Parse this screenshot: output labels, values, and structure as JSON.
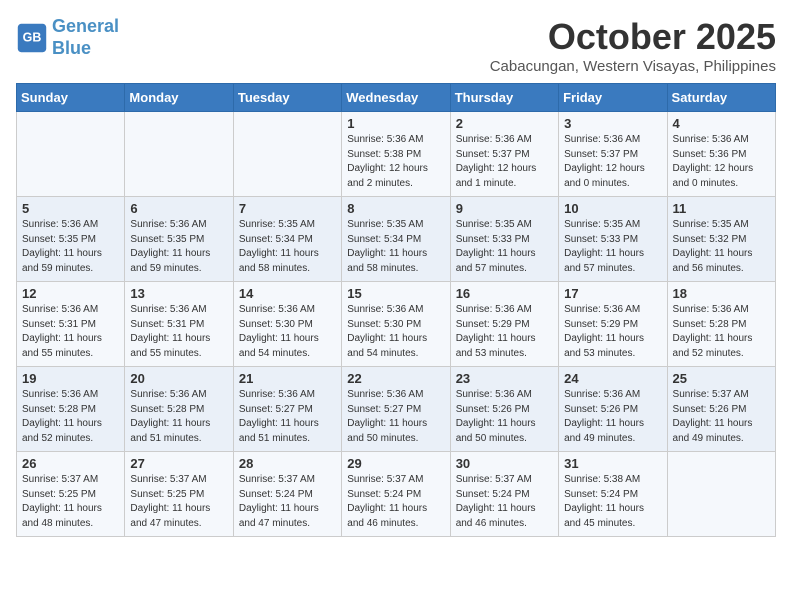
{
  "logo": {
    "line1": "General",
    "line2": "Blue"
  },
  "title": "October 2025",
  "location": "Cabacungan, Western Visayas, Philippines",
  "weekdays": [
    "Sunday",
    "Monday",
    "Tuesday",
    "Wednesday",
    "Thursday",
    "Friday",
    "Saturday"
  ],
  "weeks": [
    [
      {
        "day": "",
        "info": ""
      },
      {
        "day": "",
        "info": ""
      },
      {
        "day": "",
        "info": ""
      },
      {
        "day": "1",
        "info": "Sunrise: 5:36 AM\nSunset: 5:38 PM\nDaylight: 12 hours\nand 2 minutes."
      },
      {
        "day": "2",
        "info": "Sunrise: 5:36 AM\nSunset: 5:37 PM\nDaylight: 12 hours\nand 1 minute."
      },
      {
        "day": "3",
        "info": "Sunrise: 5:36 AM\nSunset: 5:37 PM\nDaylight: 12 hours\nand 0 minutes."
      },
      {
        "day": "4",
        "info": "Sunrise: 5:36 AM\nSunset: 5:36 PM\nDaylight: 12 hours\nand 0 minutes."
      }
    ],
    [
      {
        "day": "5",
        "info": "Sunrise: 5:36 AM\nSunset: 5:35 PM\nDaylight: 11 hours\nand 59 minutes."
      },
      {
        "day": "6",
        "info": "Sunrise: 5:36 AM\nSunset: 5:35 PM\nDaylight: 11 hours\nand 59 minutes."
      },
      {
        "day": "7",
        "info": "Sunrise: 5:35 AM\nSunset: 5:34 PM\nDaylight: 11 hours\nand 58 minutes."
      },
      {
        "day": "8",
        "info": "Sunrise: 5:35 AM\nSunset: 5:34 PM\nDaylight: 11 hours\nand 58 minutes."
      },
      {
        "day": "9",
        "info": "Sunrise: 5:35 AM\nSunset: 5:33 PM\nDaylight: 11 hours\nand 57 minutes."
      },
      {
        "day": "10",
        "info": "Sunrise: 5:35 AM\nSunset: 5:33 PM\nDaylight: 11 hours\nand 57 minutes."
      },
      {
        "day": "11",
        "info": "Sunrise: 5:35 AM\nSunset: 5:32 PM\nDaylight: 11 hours\nand 56 minutes."
      }
    ],
    [
      {
        "day": "12",
        "info": "Sunrise: 5:36 AM\nSunset: 5:31 PM\nDaylight: 11 hours\nand 55 minutes."
      },
      {
        "day": "13",
        "info": "Sunrise: 5:36 AM\nSunset: 5:31 PM\nDaylight: 11 hours\nand 55 minutes."
      },
      {
        "day": "14",
        "info": "Sunrise: 5:36 AM\nSunset: 5:30 PM\nDaylight: 11 hours\nand 54 minutes."
      },
      {
        "day": "15",
        "info": "Sunrise: 5:36 AM\nSunset: 5:30 PM\nDaylight: 11 hours\nand 54 minutes."
      },
      {
        "day": "16",
        "info": "Sunrise: 5:36 AM\nSunset: 5:29 PM\nDaylight: 11 hours\nand 53 minutes."
      },
      {
        "day": "17",
        "info": "Sunrise: 5:36 AM\nSunset: 5:29 PM\nDaylight: 11 hours\nand 53 minutes."
      },
      {
        "day": "18",
        "info": "Sunrise: 5:36 AM\nSunset: 5:28 PM\nDaylight: 11 hours\nand 52 minutes."
      }
    ],
    [
      {
        "day": "19",
        "info": "Sunrise: 5:36 AM\nSunset: 5:28 PM\nDaylight: 11 hours\nand 52 minutes."
      },
      {
        "day": "20",
        "info": "Sunrise: 5:36 AM\nSunset: 5:28 PM\nDaylight: 11 hours\nand 51 minutes."
      },
      {
        "day": "21",
        "info": "Sunrise: 5:36 AM\nSunset: 5:27 PM\nDaylight: 11 hours\nand 51 minutes."
      },
      {
        "day": "22",
        "info": "Sunrise: 5:36 AM\nSunset: 5:27 PM\nDaylight: 11 hours\nand 50 minutes."
      },
      {
        "day": "23",
        "info": "Sunrise: 5:36 AM\nSunset: 5:26 PM\nDaylight: 11 hours\nand 50 minutes."
      },
      {
        "day": "24",
        "info": "Sunrise: 5:36 AM\nSunset: 5:26 PM\nDaylight: 11 hours\nand 49 minutes."
      },
      {
        "day": "25",
        "info": "Sunrise: 5:37 AM\nSunset: 5:26 PM\nDaylight: 11 hours\nand 49 minutes."
      }
    ],
    [
      {
        "day": "26",
        "info": "Sunrise: 5:37 AM\nSunset: 5:25 PM\nDaylight: 11 hours\nand 48 minutes."
      },
      {
        "day": "27",
        "info": "Sunrise: 5:37 AM\nSunset: 5:25 PM\nDaylight: 11 hours\nand 47 minutes."
      },
      {
        "day": "28",
        "info": "Sunrise: 5:37 AM\nSunset: 5:24 PM\nDaylight: 11 hours\nand 47 minutes."
      },
      {
        "day": "29",
        "info": "Sunrise: 5:37 AM\nSunset: 5:24 PM\nDaylight: 11 hours\nand 46 minutes."
      },
      {
        "day": "30",
        "info": "Sunrise: 5:37 AM\nSunset: 5:24 PM\nDaylight: 11 hours\nand 46 minutes."
      },
      {
        "day": "31",
        "info": "Sunrise: 5:38 AM\nSunset: 5:24 PM\nDaylight: 11 hours\nand 45 minutes."
      },
      {
        "day": "",
        "info": ""
      }
    ]
  ]
}
